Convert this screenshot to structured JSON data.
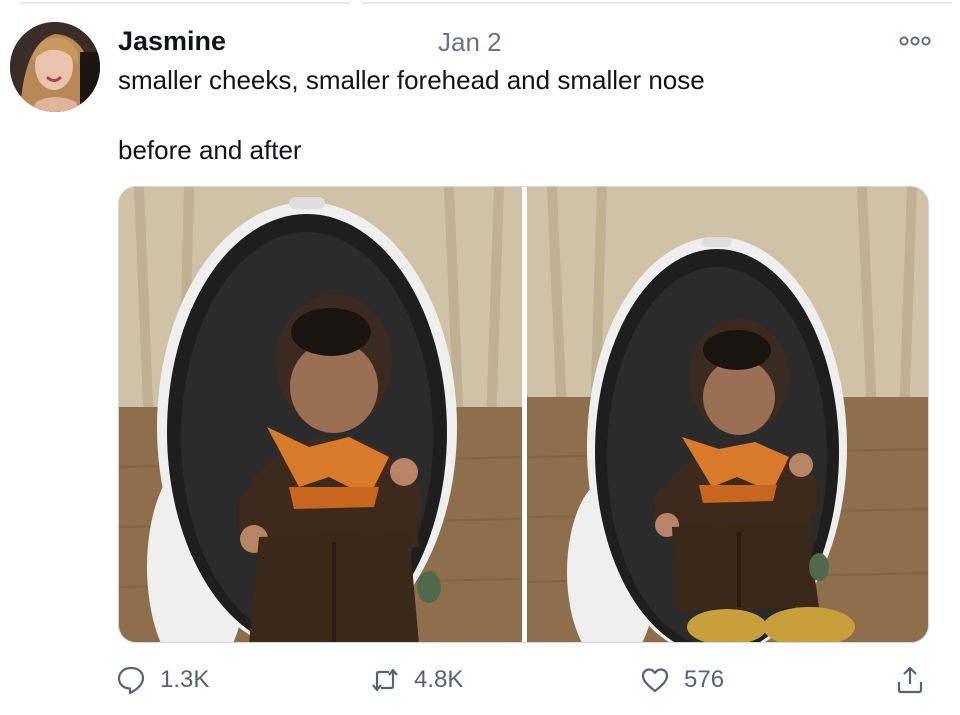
{
  "tweet": {
    "author_name": "Jasmine",
    "date": "Jan 2",
    "text_line1": "smaller cheeks, smaller forehead and smaller nose",
    "text_line2": "before and after",
    "images": [
      {
        "label": "before-photo"
      },
      {
        "label": "after-photo"
      }
    ],
    "stats": {
      "replies": "1.3K",
      "retweets": "4.8K",
      "likes": "576"
    }
  },
  "icons": {
    "more": "more-horizontal-icon",
    "reply": "speech-bubble-icon",
    "retweet": "retweet-arrows-icon",
    "like": "heart-icon",
    "share": "share-upload-icon"
  },
  "colors": {
    "text_primary": "#0f1419",
    "text_secondary": "#536471",
    "date_gray": "#687684",
    "border": "#cfd9de"
  }
}
